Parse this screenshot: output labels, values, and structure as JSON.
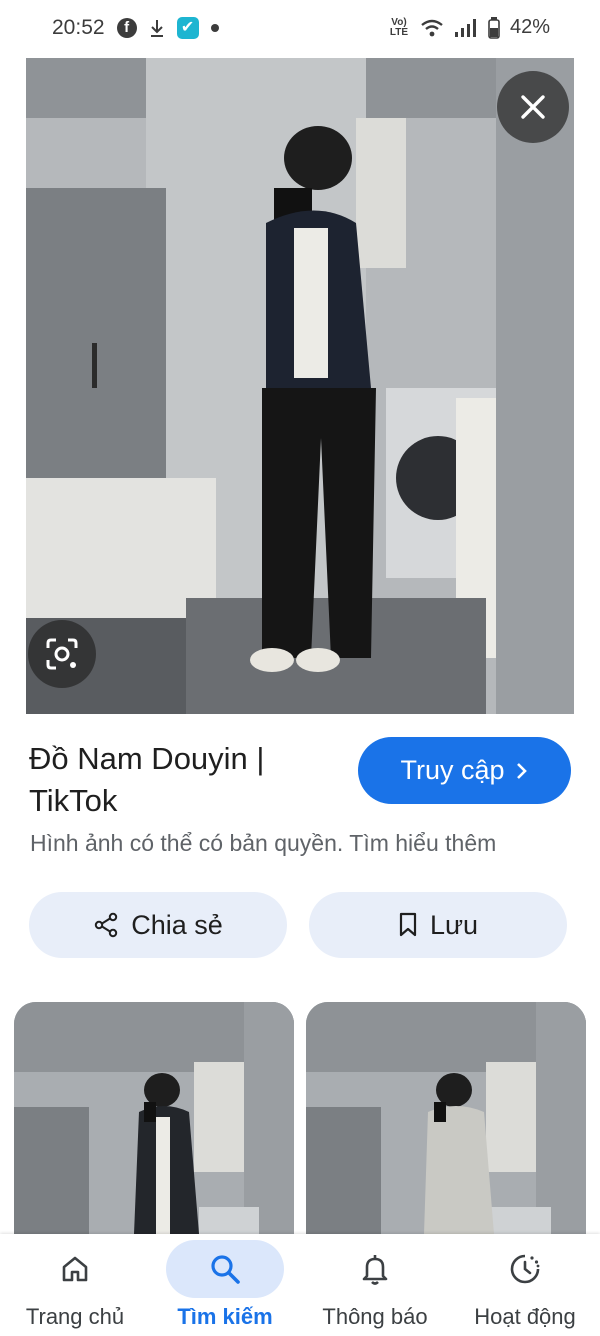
{
  "status_bar": {
    "time": "20:52",
    "battery": "42%",
    "network_label": "Vo) LTE"
  },
  "result": {
    "title": "Đồ Nam Douyin | TikTok",
    "visit_label": "Truy cập",
    "copyright_text": "Hình ảnh có thể có bản quyền.",
    "learn_more": "Tìm hiểu thêm"
  },
  "actions": {
    "share_label": "Chia sẻ",
    "save_label": "Lưu"
  },
  "bottom_nav": {
    "items": [
      {
        "label": "Trang chủ",
        "icon": "home-icon"
      },
      {
        "label": "Tìm kiếm",
        "icon": "search-icon",
        "active": true
      },
      {
        "label": "Thông báo",
        "icon": "bell-icon"
      },
      {
        "label": "Hoạt động",
        "icon": "history-icon"
      }
    ]
  },
  "colors": {
    "accent": "#1a73e8",
    "chip_bg": "#e8eef9",
    "nav_active_bg": "#dbe7fb"
  }
}
